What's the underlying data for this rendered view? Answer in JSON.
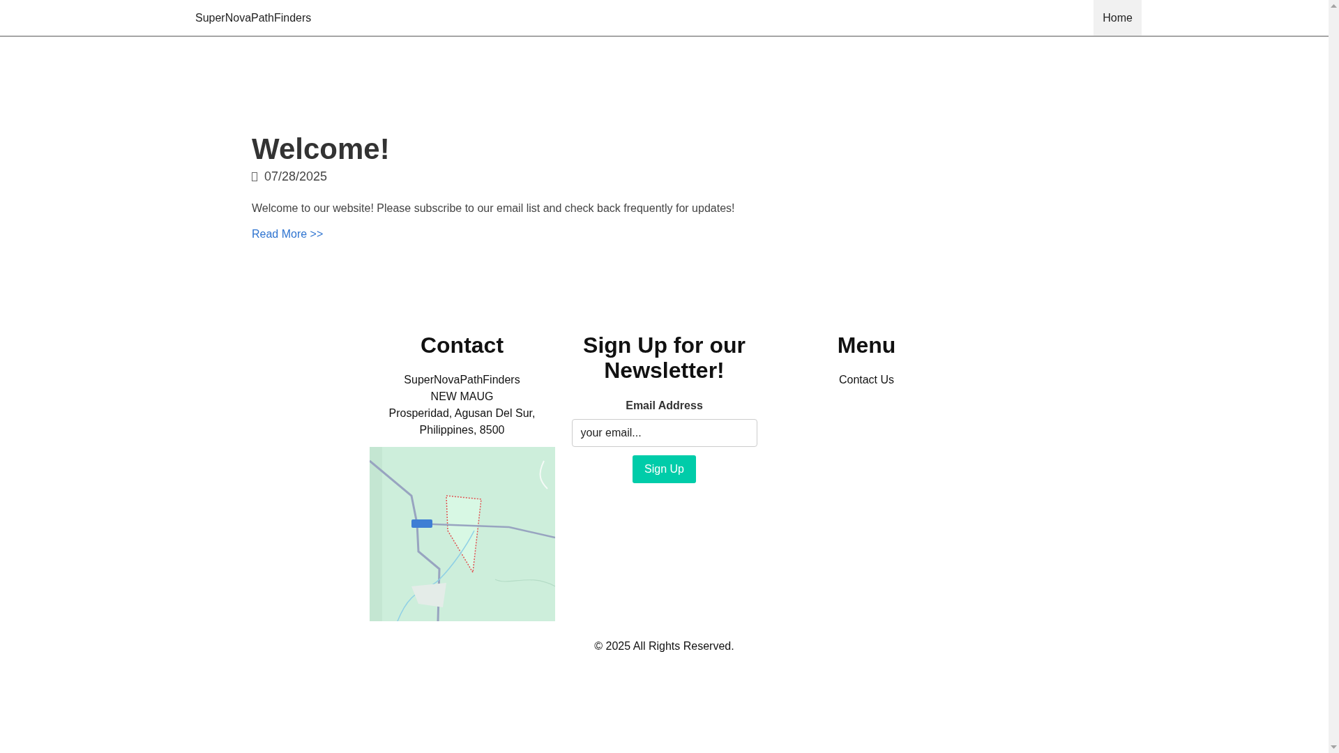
{
  "navbar": {
    "brand": "SuperNovaPathFinders",
    "links": [
      {
        "label": "Home",
        "selected": true
      }
    ]
  },
  "post": {
    "title": "Welcome!",
    "date": "07/28/2025",
    "body": "Welcome to our website! Please subscribe to our email list and check back frequently for updates!",
    "link": "Read More >>"
  },
  "footer": {
    "contact": {
      "title": "Contact",
      "lines": [
        "SuperNovaPathFinders",
        "NEW MAUG",
        "Prosperidad, Agusan Del Sur, Philippines, 8500"
      ]
    },
    "newsletter": {
      "title": "Sign Up for our Newsletter!",
      "label": "Email Address",
      "placeholder": "your email...",
      "button": "Sign Up"
    },
    "menu": {
      "title": "Menu",
      "links": [
        "Contact Us"
      ]
    },
    "copyright": "© 2025 All Rights Reserved."
  }
}
